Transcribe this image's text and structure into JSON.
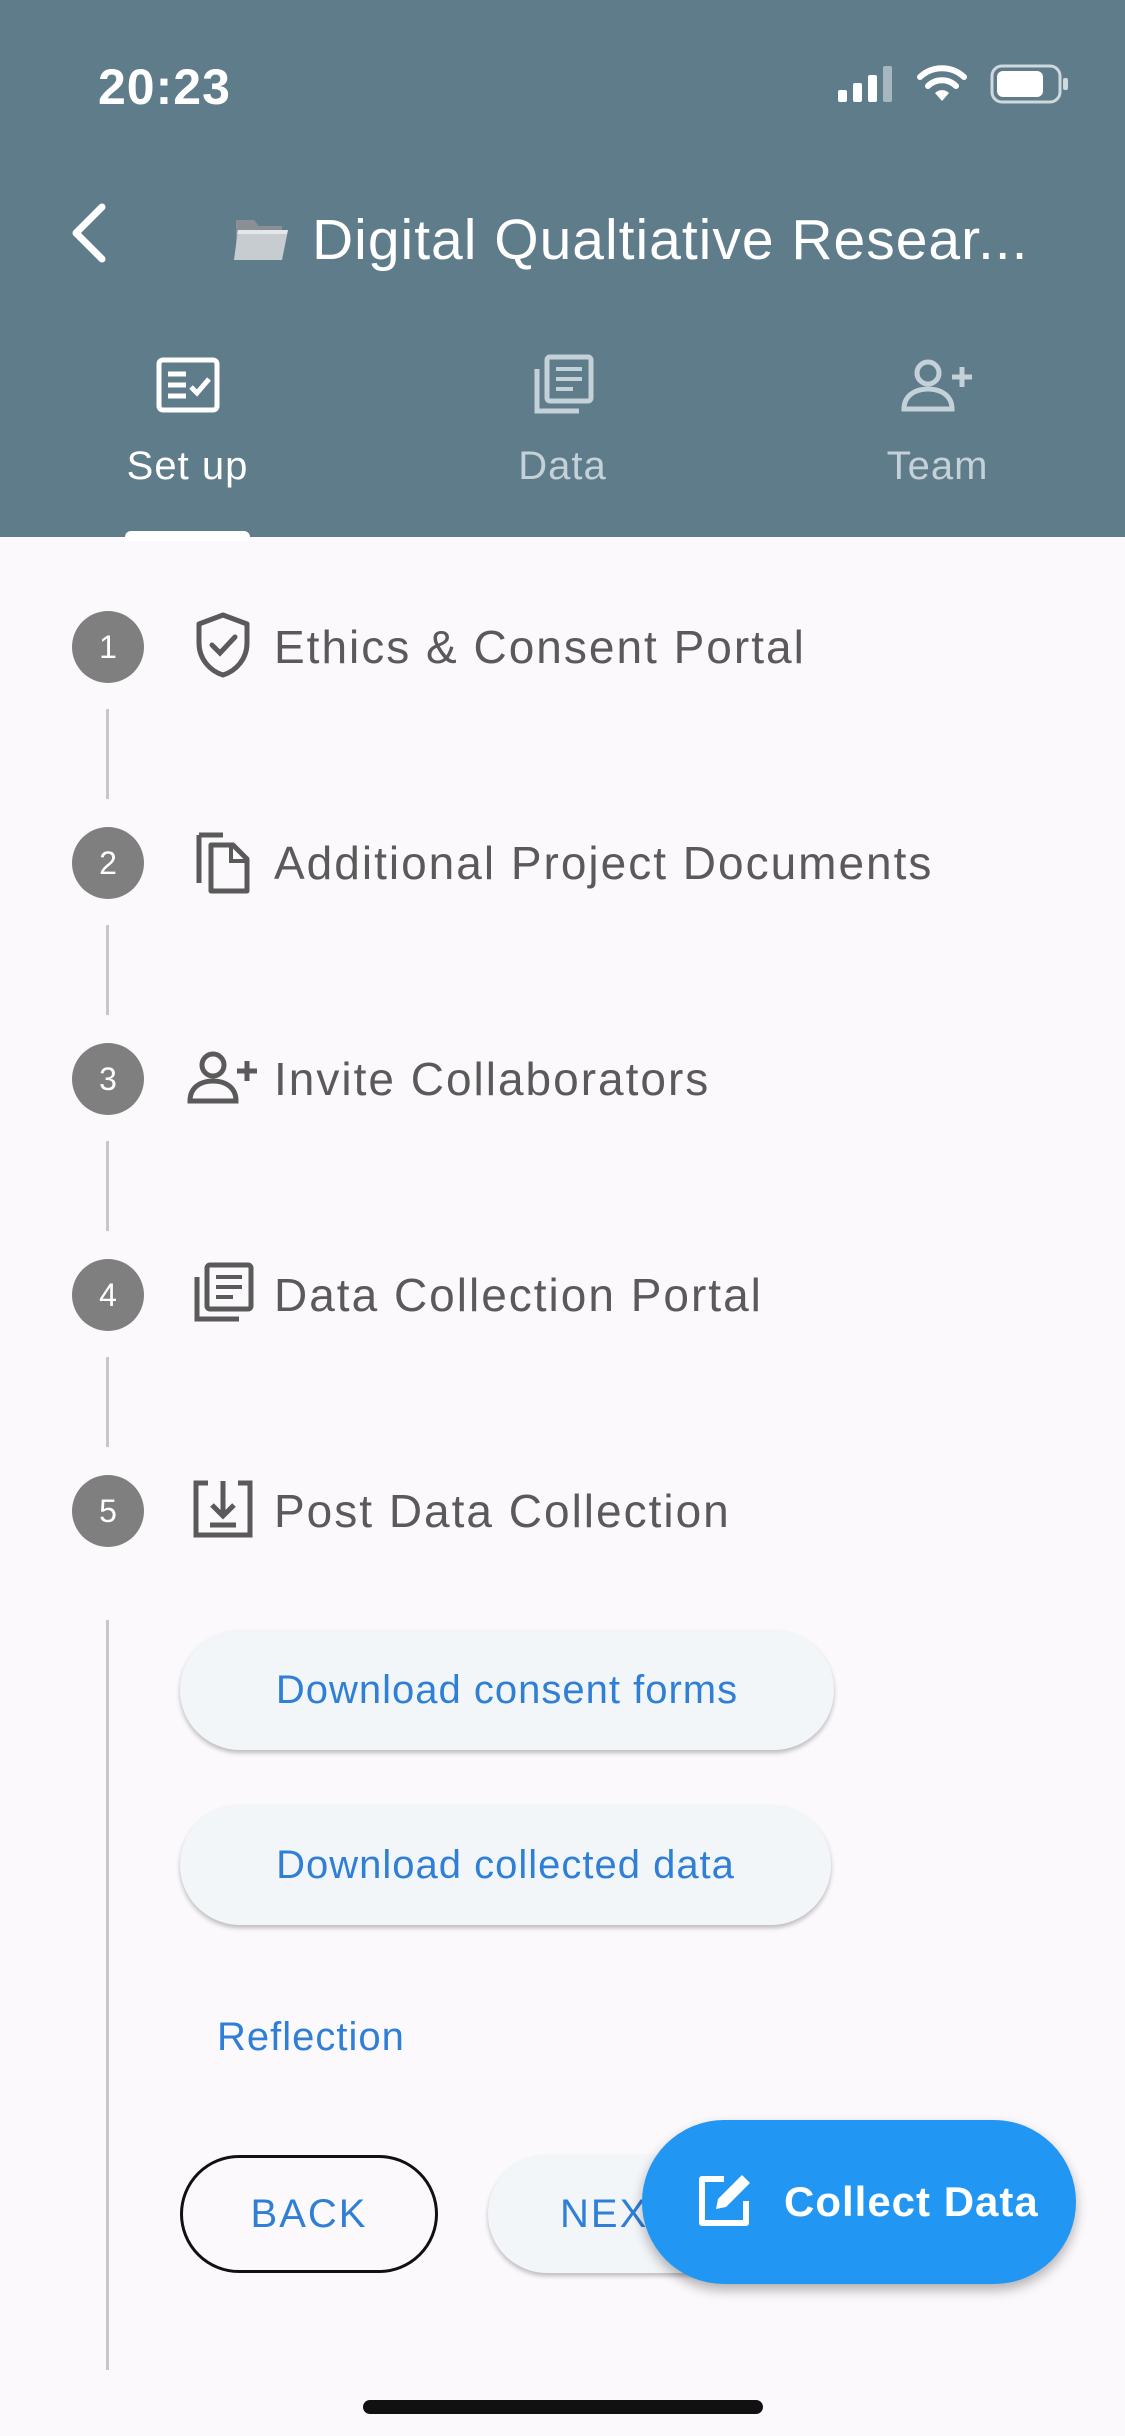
{
  "status_bar": {
    "time": "20:23"
  },
  "header": {
    "back_icon": "chevron-left-icon",
    "title_icon": "folder-icon",
    "title": "Digital Qualtiative Resear..."
  },
  "tabs": [
    {
      "label": "Set up",
      "icon": "checklist-icon",
      "active": true
    },
    {
      "label": "Data",
      "icon": "document-stack-icon",
      "active": false
    },
    {
      "label": "Team",
      "icon": "person-add-icon",
      "active": false
    }
  ],
  "steps": [
    {
      "number": "1",
      "icon": "shield-check-icon",
      "label": "Ethics & Consent Portal"
    },
    {
      "number": "2",
      "icon": "documents-copy-icon",
      "label": "Additional Project Documents"
    },
    {
      "number": "3",
      "icon": "person-add-icon",
      "label": "Invite Collaborators"
    },
    {
      "number": "4",
      "icon": "document-stack-icon",
      "label": "Data Collection Portal"
    },
    {
      "number": "5",
      "icon": "download-box-icon",
      "label": "Post Data Collection"
    }
  ],
  "step5_actions": {
    "download_consent": "Download consent forms",
    "download_data": "Download collected data",
    "reflection": "Reflection"
  },
  "nav": {
    "back": "BACK",
    "next": "NEXT"
  },
  "fab": {
    "label": "Collect Data",
    "icon": "edit-square-icon"
  },
  "colors": {
    "header": "#5f7c8b",
    "accent": "#2196f3",
    "link": "#2f7fd6"
  }
}
